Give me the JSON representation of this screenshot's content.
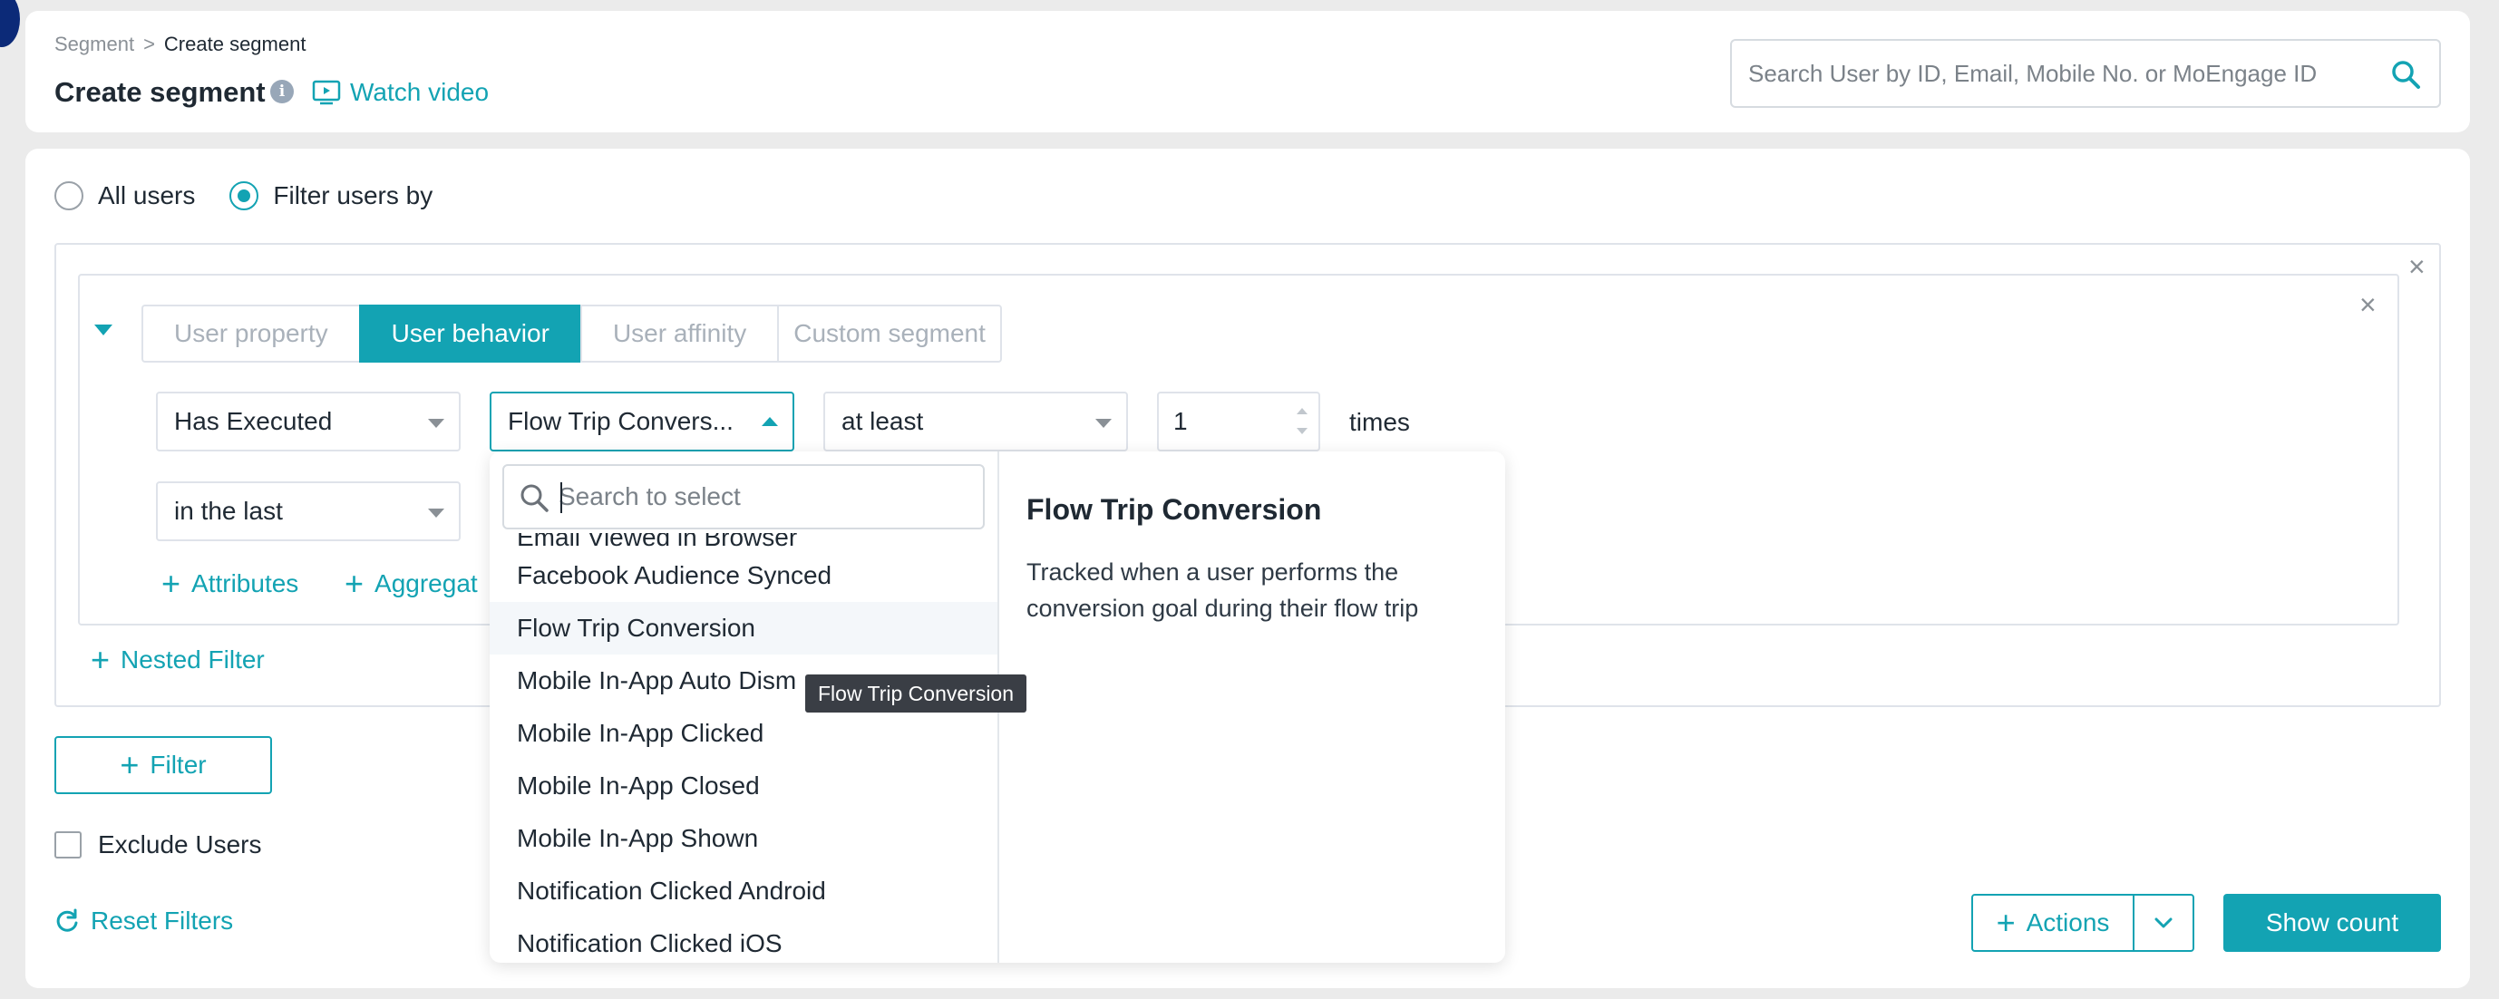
{
  "breadcrumb": {
    "parent": "Segment",
    "separator": ">",
    "current": "Create segment"
  },
  "header": {
    "title": "Create segment",
    "info_icon": "i",
    "watch_video": "Watch video",
    "search_placeholder": "Search User by ID, Email, Mobile No. or MoEngage ID"
  },
  "audience": {
    "options": [
      {
        "label": "All users",
        "selected": false
      },
      {
        "label": "Filter users by",
        "selected": true
      }
    ]
  },
  "filter": {
    "tabs": [
      {
        "label": "User property",
        "active": false
      },
      {
        "label": "User behavior",
        "active": true
      },
      {
        "label": "User affinity",
        "active": false
      },
      {
        "label": "Custom segment",
        "active": false
      }
    ],
    "execution_select": "Has Executed",
    "event_select": "Flow Trip Convers...",
    "frequency_select": "at least",
    "count_value": "1",
    "times_label": "times",
    "time_select": "in the last",
    "attributes_link": "Attributes",
    "aggregation_link": "Aggregat",
    "nested_filter_link": "Nested Filter",
    "close_symbol": "×"
  },
  "event_dropdown": {
    "search_placeholder": "Search to select",
    "partial_top_item": "Email Viewed in Browser",
    "items": [
      "Facebook Audience Synced",
      "Flow Trip Conversion",
      "Mobile In-App Auto Dism",
      "Mobile In-App Clicked",
      "Mobile In-App Closed",
      "Mobile In-App Shown",
      "Notification Clicked Android"
    ],
    "partial_bottom_item": "Notification Clicked iOS",
    "highlighted_item": "Flow Trip Conversion",
    "detail_title": "Flow Trip Conversion",
    "detail_description": "Tracked when a user performs the conversion goal during their flow trip",
    "tooltip": "Flow Trip Conversion"
  },
  "footer": {
    "add_filter": "Filter",
    "exclude_users": "Exclude Users",
    "reset_filters": "Reset Filters",
    "actions": "Actions",
    "show_count": "Show count"
  },
  "colors": {
    "accent": "#13a3b3",
    "background": "#ebebeb",
    "card": "#ffffff",
    "border": "#dfe3ea",
    "tooltip_bg": "#3a3e45",
    "corner_badge": "#0c2a78"
  }
}
